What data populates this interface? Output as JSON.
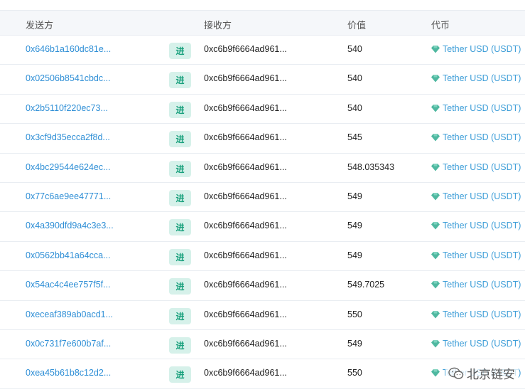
{
  "header": {
    "from": "发送方",
    "to": "接收方",
    "value": "价值",
    "token": "代币"
  },
  "direction_label": "进",
  "token_name": "Tether USD (USDT)",
  "colors": {
    "link": "#2f8fd6",
    "badge_bg": "#d6f1ea",
    "badge_text": "#18a07c",
    "token_gem": "#4fb8a0"
  },
  "rows": [
    {
      "from": "0x646b1a160dc81e...",
      "to": "0xc6b9f6664ad961...",
      "value": "540"
    },
    {
      "from": "0x02506b8541cbdc...",
      "to": "0xc6b9f6664ad961...",
      "value": "540"
    },
    {
      "from": "0x2b5110f220ec73...",
      "to": "0xc6b9f6664ad961...",
      "value": "540"
    },
    {
      "from": "0x3cf9d35ecca2f8d...",
      "to": "0xc6b9f6664ad961...",
      "value": "545"
    },
    {
      "from": "0x4bc29544e624ec...",
      "to": "0xc6b9f6664ad961...",
      "value": "548.035343"
    },
    {
      "from": "0x77c6ae9ee47771...",
      "to": "0xc6b9f6664ad961...",
      "value": "549"
    },
    {
      "from": "0x4a390dfd9a4c3e3...",
      "to": "0xc6b9f6664ad961...",
      "value": "549"
    },
    {
      "from": "0x0562bb41a64cca...",
      "to": "0xc6b9f6664ad961...",
      "value": "549"
    },
    {
      "from": "0x54ac4c4ee757f5f...",
      "to": "0xc6b9f6664ad961...",
      "value": "549.7025"
    },
    {
      "from": "0xeceaf389ab0acd1...",
      "to": "0xc6b9f6664ad961...",
      "value": "550"
    },
    {
      "from": "0x0c731f7e600b7af...",
      "to": "0xc6b9f6664ad961...",
      "value": "549"
    },
    {
      "from": "0xea45b61b8c12d2...",
      "to": "0xc6b9f6664ad961...",
      "value": "550"
    }
  ],
  "watermark": {
    "text": "北京链安",
    "icon": "wechat-icon"
  }
}
